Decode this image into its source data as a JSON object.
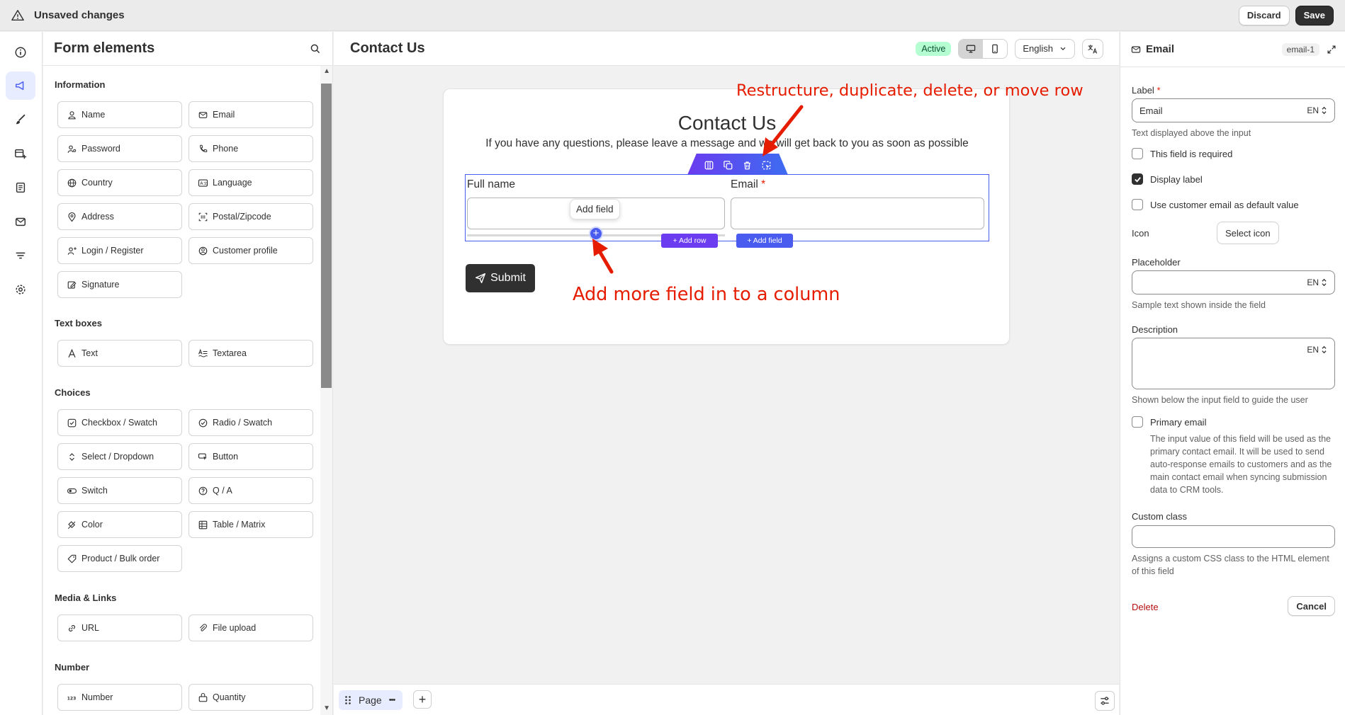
{
  "topbar": {
    "title": "Unsaved changes",
    "discard": "Discard",
    "save": "Save"
  },
  "rail": {
    "icons": [
      "info-icon",
      "megaphone-icon",
      "brush-icon",
      "form-add-icon",
      "article-icon",
      "email-icon",
      "filter-icon",
      "gear-icon"
    ]
  },
  "elements": {
    "title": "Form elements",
    "sections": {
      "information": "Information",
      "text_boxes": "Text boxes",
      "choices": "Choices",
      "media": "Media & Links",
      "number": "Number"
    },
    "items": {
      "name": "Name",
      "email": "Email",
      "password": "Password",
      "phone": "Phone",
      "country": "Country",
      "language": "Language",
      "address": "Address",
      "postal": "Postal/Zipcode",
      "login": "Login / Register",
      "customer_profile": "Customer profile",
      "signature": "Signature",
      "text": "Text",
      "textarea": "Textarea",
      "checkbox": "Checkbox / Swatch",
      "radio": "Radio / Swatch",
      "select": "Select / Dropdown",
      "button": "Button",
      "switch": "Switch",
      "qa": "Q / A",
      "color": "Color",
      "table": "Table / Matrix",
      "product": "Product / Bulk order",
      "url": "URL",
      "file_upload": "File upload",
      "number": "Number",
      "quantity": "Quantity"
    }
  },
  "canvas": {
    "title": "Contact Us",
    "status": "Active",
    "language": "English",
    "form": {
      "title": "Contact Us",
      "subtitle": "If you have any questions, please leave a message and we will get back to you as soon as possible",
      "field1_label": "Full name",
      "field2_label": "Email",
      "required_mark": "*",
      "tooltip": "Add field",
      "add_row": "+ Add row",
      "add_field": "+ Add field",
      "submit": "Submit"
    },
    "annotations": {
      "top": "Restructure, duplicate, delete, or move row",
      "bottom": "Add more field in to a column"
    },
    "footer": {
      "page_tab": "Page",
      "more": "•••",
      "add": "+"
    }
  },
  "props": {
    "title": "Email",
    "id": "email-1",
    "label_label": "Label",
    "required_mark": "*",
    "label_value": "Email",
    "lang_code": "EN",
    "label_help": "Text displayed above the input",
    "required_check": "This field is required",
    "display_label_check": "Display label",
    "customer_email_check": "Use customer email as default value",
    "icon_label": "Icon",
    "select_icon": "Select icon",
    "placeholder_label": "Placeholder",
    "placeholder_help": "Sample text shown inside the field",
    "description_label": "Description",
    "description_help": "Shown below the input field to guide the user",
    "primary_email_check": "Primary email",
    "primary_email_help": "The input value of this field will be used as the primary contact email. It will be used to send auto-response emails to customers and as the main contact email when syncing submission data to CRM tools.",
    "custom_class_label": "Custom class",
    "custom_class_help": "Assigns a custom CSS class to the HTML element of this field",
    "delete": "Delete",
    "cancel": "Cancel"
  },
  "colors": {
    "accent": "#4a5cf0",
    "purple": "#6b3cf0",
    "annotation": "#e51c00",
    "active_badge": "#b4fed2"
  }
}
